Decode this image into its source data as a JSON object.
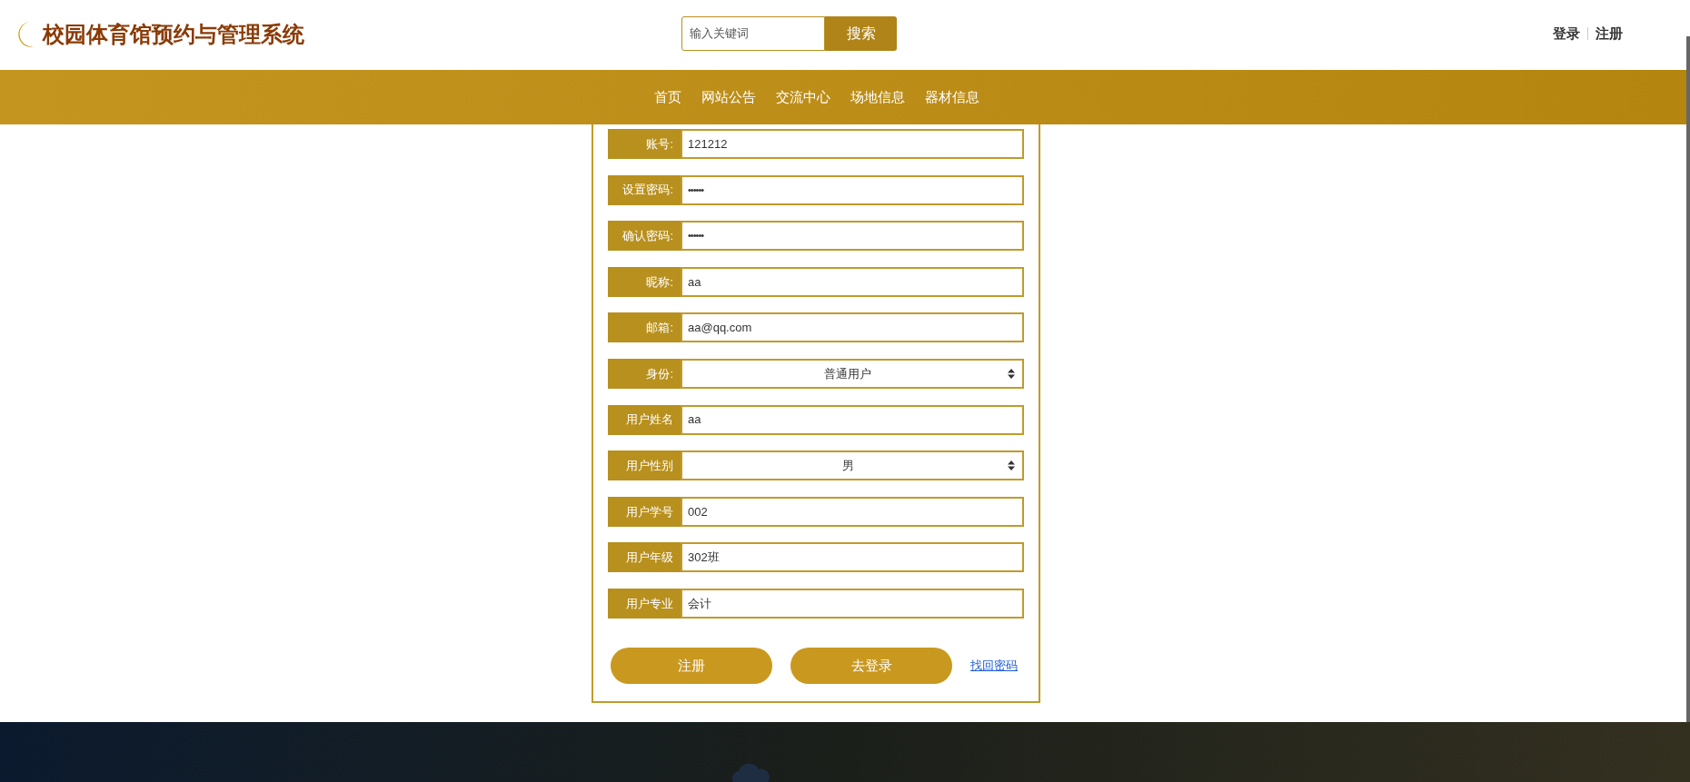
{
  "header": {
    "site_title": "校园体育馆预约与管理系统",
    "search": {
      "placeholder": "输入关键词",
      "button": "搜索"
    },
    "auth_links": [
      "登录",
      "注册"
    ]
  },
  "nav": {
    "items": [
      "首页",
      "网站公告",
      "交流中心",
      "场地信息",
      "器材信息"
    ]
  },
  "form": {
    "fields": [
      {
        "kind": "text",
        "label": "账号:",
        "value": "121212"
      },
      {
        "kind": "password",
        "label": "设置密码:",
        "value": "••••••"
      },
      {
        "kind": "password",
        "label": "确认密码:",
        "value": "••••••"
      },
      {
        "kind": "text",
        "label": "昵称:",
        "value": "aa"
      },
      {
        "kind": "text",
        "label": "邮箱:",
        "value": "aa@qq.com"
      },
      {
        "kind": "select",
        "label": "身份:",
        "value": "普通用户"
      },
      {
        "kind": "text",
        "label": "用户姓名",
        "value": "aa"
      },
      {
        "kind": "select",
        "label": "用户性别",
        "value": "男"
      },
      {
        "kind": "text",
        "label": "用户学号",
        "value": "002"
      },
      {
        "kind": "text",
        "label": "用户年级",
        "value": "302班"
      },
      {
        "kind": "text",
        "label": "用户专业",
        "value": "会计"
      }
    ],
    "buttons": [
      "注册",
      "去登录"
    ],
    "link": "找回密码"
  }
}
